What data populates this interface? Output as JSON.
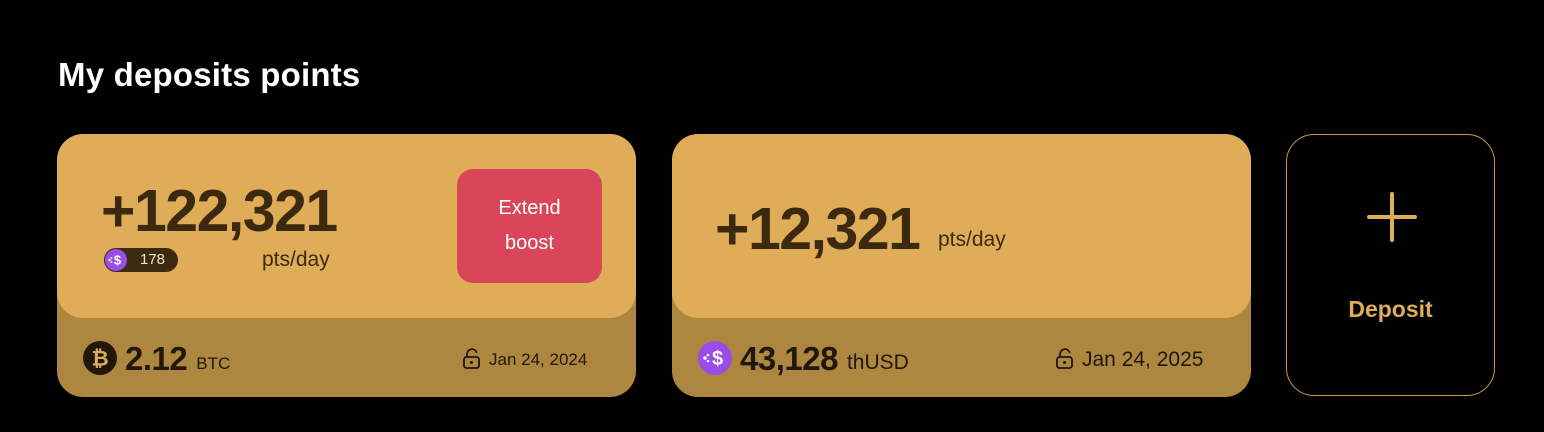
{
  "section": {
    "title": "My deposits points"
  },
  "cards": [
    {
      "points": "+122,321",
      "points_unit": "pts/day",
      "boost_badge": {
        "icon": "thusd-coin-icon",
        "value": "178"
      },
      "extend_button": {
        "line1": "Extend",
        "line2": "boost"
      },
      "token": {
        "icon": "bitcoin-icon",
        "amount": "2.12",
        "unit": "BTC"
      },
      "unlock": {
        "icon": "unlock-icon",
        "date": "Jan 24, 2024"
      }
    },
    {
      "points": "+12,321",
      "points_unit": "pts/day",
      "token": {
        "icon": "thusd-coin-icon",
        "amount": "43,128",
        "unit": "thUSD"
      },
      "unlock": {
        "icon": "unlock-icon",
        "date": "Jan 24, 2025"
      }
    }
  ],
  "deposit_action": {
    "icon": "plus-icon",
    "label": "Deposit"
  },
  "colors": {
    "background": "#000000",
    "card_top": "#dfad57",
    "card_bottom": "#ad8640",
    "text_dark": "#3b2a10",
    "boost_button": "#d9465a",
    "accent_gold": "#dfad57",
    "thusd_purple": "#9b4be8"
  }
}
